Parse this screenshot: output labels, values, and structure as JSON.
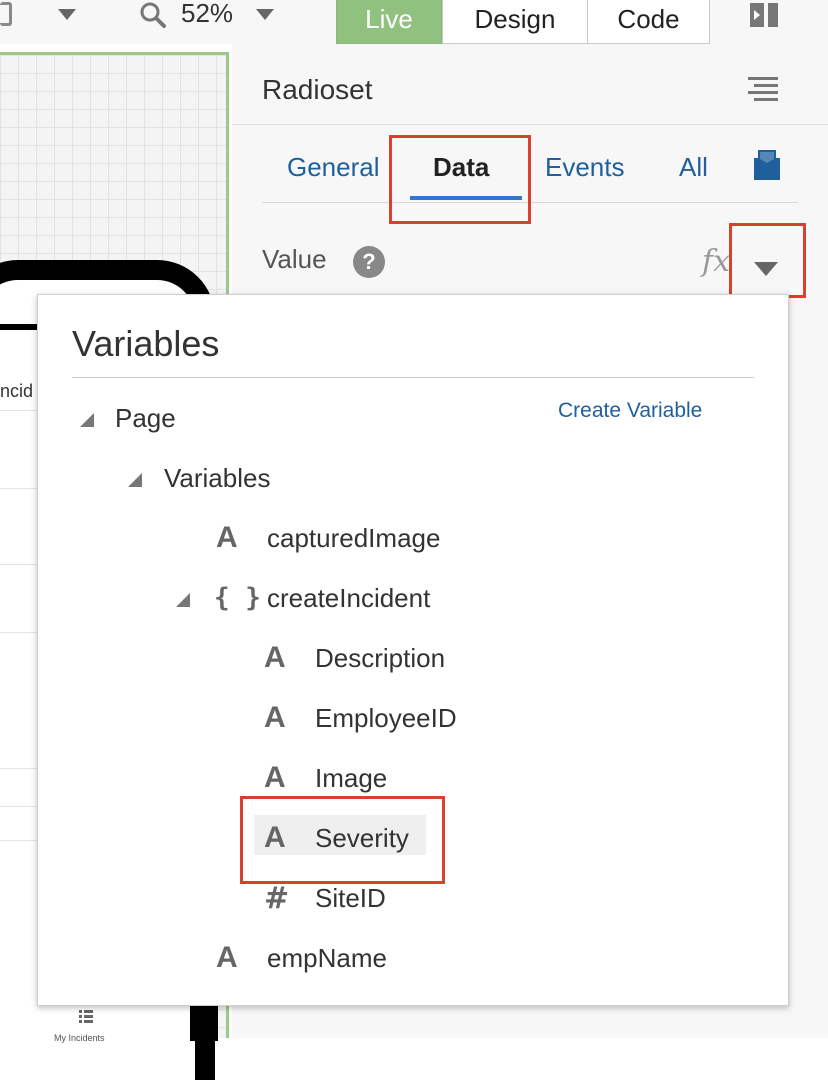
{
  "toolbar": {
    "zoom": "52%",
    "tabs": [
      {
        "label": "Live"
      },
      {
        "label": "Design"
      },
      {
        "label": "Code"
      }
    ]
  },
  "canvas": {
    "partial_label": "ncid",
    "tab_label": "My Incidents"
  },
  "panel": {
    "title": "Radioset",
    "tabs": [
      {
        "label": "General"
      },
      {
        "label": "Data"
      },
      {
        "label": "Events"
      },
      {
        "label": "All"
      }
    ],
    "active_tab": "Data",
    "field_label": "Value",
    "help_glyph": "?",
    "fx_label": "fx"
  },
  "popup": {
    "title": "Variables",
    "create_link": "Create Variable",
    "tree": {
      "page": "Page",
      "variables_group": "Variables",
      "items": [
        {
          "name": "capturedImage",
          "type": "string"
        },
        {
          "name": "createIncident",
          "type": "object",
          "children": [
            {
              "name": "Description",
              "type": "string"
            },
            {
              "name": "EmployeeID",
              "type": "string"
            },
            {
              "name": "Image",
              "type": "string"
            },
            {
              "name": "Severity",
              "type": "string",
              "selected": true
            },
            {
              "name": "SiteID",
              "type": "number"
            }
          ]
        },
        {
          "name": "empName",
          "type": "string"
        }
      ]
    },
    "type_glyphs": {
      "string": "A",
      "object": "{ }",
      "number": "#"
    }
  },
  "colors": {
    "live_tab": "#90c17f",
    "link": "#1f5f9e",
    "active_underline": "#2c7ac9",
    "highlight": "#d9412f"
  }
}
